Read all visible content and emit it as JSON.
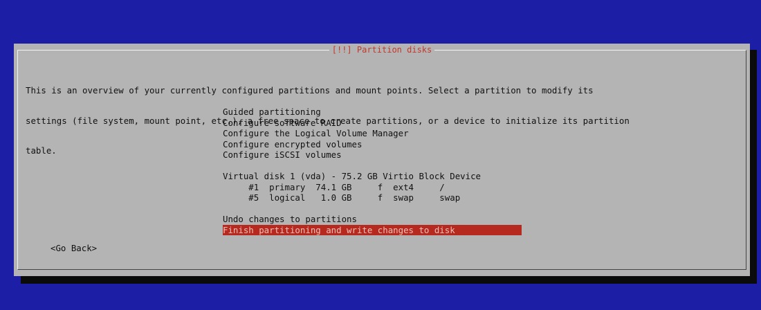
{
  "dialog": {
    "title": "[!!] Partition disks",
    "description_lines": [
      "This is an overview of your currently configured partitions and mount points. Select a partition to modify its",
      "settings (file system, mount point, etc.), a free space to create partitions, or a device to initialize its partition",
      "table."
    ]
  },
  "menu": {
    "actions": [
      "Guided partitioning",
      "Configure software RAID",
      "Configure the Logical Volume Manager",
      "Configure encrypted volumes",
      "Configure iSCSI volumes"
    ],
    "disk": "Virtual disk 1 (vda) - 75.2 GB Virtio Block Device",
    "partitions": [
      "     #1  primary  74.1 GB     f  ext4     /",
      "     #5  logical   1.0 GB     f  swap     swap"
    ],
    "undo": "Undo changes to partitions",
    "finish": "Finish partitioning and write changes to disk"
  },
  "buttons": {
    "go_back": "<Go Back>"
  },
  "colors": {
    "background": "#1c1fa6",
    "dialog": "#b4b4b4",
    "selection": "#b6291e",
    "title": "#c0392b"
  }
}
